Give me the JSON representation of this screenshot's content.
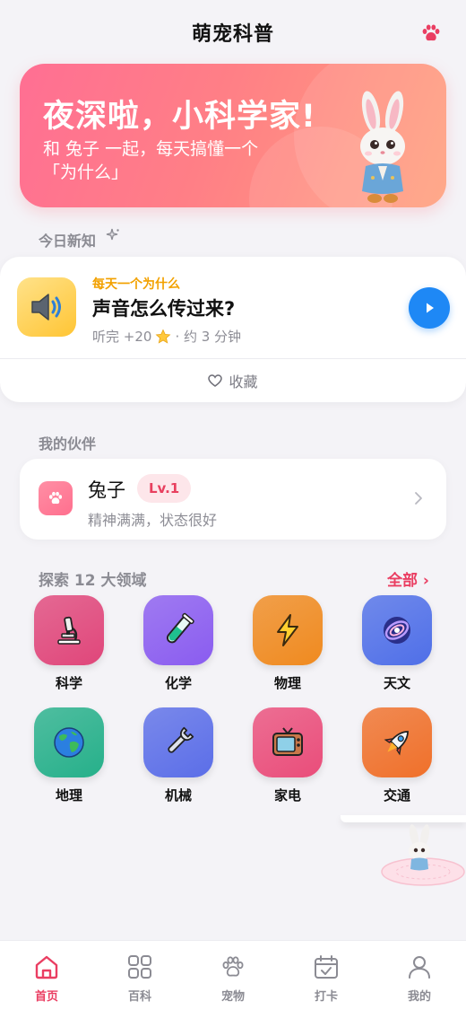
{
  "header": {
    "title": "萌宠科普",
    "icon": "paw-icon",
    "accent": "#ea3e62"
  },
  "banner": {
    "title": "夜深啦，小科学家!",
    "subtitle": "和 兔子 一起，每天搞懂一个「为什么」",
    "image": "rabbit-mascot"
  },
  "today": {
    "label": "今日新知",
    "kicker": "每天一个为什么",
    "title": "声音怎么传过来?",
    "reward_prefix": "听完 +20",
    "reward_icon": "star-icon",
    "duration": "· 约 3 分钟",
    "icon": "speaker-icon",
    "play_icon": "play-icon",
    "favorite_label": "收藏"
  },
  "partner": {
    "label": "我的伙伴",
    "name": "兔子",
    "level": "Lv.1",
    "status": "精神满满，状态很好"
  },
  "explore": {
    "label": "探索 12 大领域",
    "all_label": "全部 ›",
    "categories": [
      {
        "label": "科学",
        "icon": "microscope-icon",
        "color": "#e0467a"
      },
      {
        "label": "化学",
        "icon": "test-tube-icon",
        "color": "#8a5cf0"
      },
      {
        "label": "物理",
        "icon": "lightning-icon",
        "color": "#f08a1f"
      },
      {
        "label": "天文",
        "icon": "galaxy-icon",
        "color": "#4f6fe8"
      },
      {
        "label": "地理",
        "icon": "globe-icon",
        "color": "#26b08a"
      },
      {
        "label": "机械",
        "icon": "wrench-icon",
        "color": "#5b6ee8"
      },
      {
        "label": "家电",
        "icon": "tv-icon",
        "color": "#ea4d7a"
      },
      {
        "label": "交通",
        "icon": "rocket-icon",
        "color": "#f0702a"
      }
    ]
  },
  "tabbar": {
    "items": [
      {
        "label": "首页",
        "icon": "home-icon",
        "active": true
      },
      {
        "label": "百科",
        "icon": "grid-icon",
        "active": false
      },
      {
        "label": "宠物",
        "icon": "paw-icon",
        "active": false
      },
      {
        "label": "打卡",
        "icon": "calendar-check-icon",
        "active": false
      },
      {
        "label": "我的",
        "icon": "user-icon",
        "active": false
      }
    ]
  }
}
